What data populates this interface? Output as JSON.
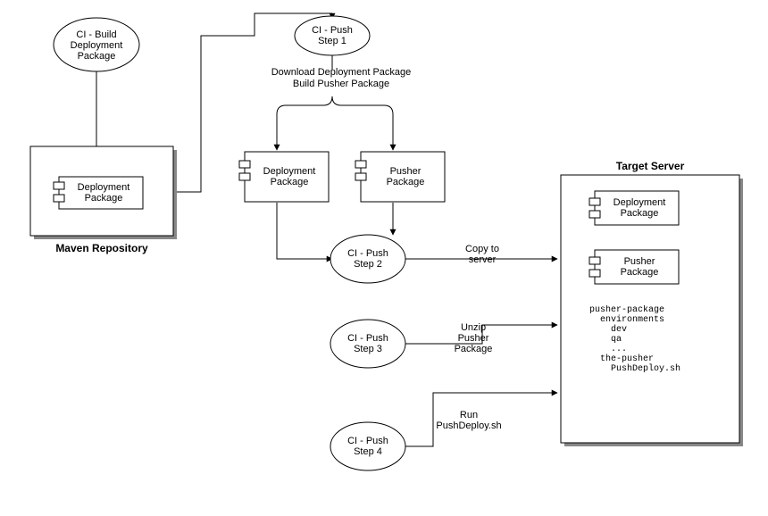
{
  "ellipses": {
    "build": {
      "l1": "CI - Build",
      "l2": "Deployment",
      "l3": "Package"
    },
    "push1": {
      "l1": "CI - Push",
      "l2": "Step 1"
    },
    "push2": {
      "l1": "CI - Push",
      "l2": "Step 2"
    },
    "push3": {
      "l1": "CI - Push",
      "l2": "Step 3"
    },
    "push4": {
      "l1": "CI - Push",
      "l2": "Step 4"
    }
  },
  "components": {
    "depPkg": {
      "l1": "Deployment",
      "l2": "Package"
    },
    "pushPkg": {
      "l1": "Pusher",
      "l2": "Package"
    }
  },
  "containers": {
    "maven": "Maven Repository",
    "target": "Target Server"
  },
  "annot": {
    "download": {
      "l1": "Download Deployment Package",
      "l2": "Build Pusher Package"
    },
    "copy": {
      "l1": "Copy to",
      "l2": "server"
    },
    "unzip": {
      "l1": "Unzip",
      "l2": "Pusher",
      "l3": "Package"
    },
    "run": {
      "l1": "Run",
      "l2": "PushDeploy.sh"
    }
  },
  "tree": "pusher-package\n  environments\n    dev\n    qa\n    ...\n  the-pusher\n    PushDeploy.sh"
}
